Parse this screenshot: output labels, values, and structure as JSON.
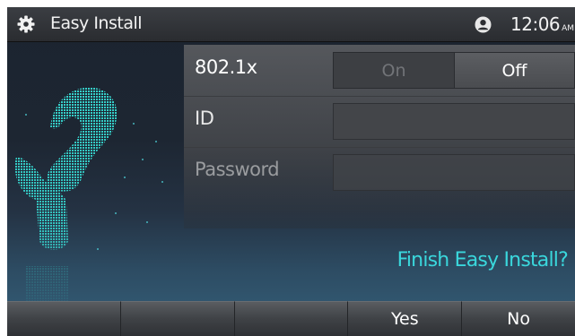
{
  "status_bar": {
    "title": "Easy Install",
    "time": "12:06",
    "ampm": "AM",
    "icons": {
      "left": "gear-icon",
      "right": "user-icon"
    }
  },
  "settings": {
    "rows": [
      {
        "label": "802.1x",
        "type": "toggle",
        "options": [
          "On",
          "Off"
        ],
        "selected": "Off"
      },
      {
        "label": "ID",
        "type": "text",
        "value": ""
      },
      {
        "label": "Password",
        "type": "password",
        "value": ""
      }
    ]
  },
  "prompt": "Finish Easy Install?",
  "softkeys": [
    "",
    "",
    "",
    "Yes",
    "No"
  ],
  "colors": {
    "accent": "#3ad7dc",
    "question_mark": "#35e0d8"
  }
}
